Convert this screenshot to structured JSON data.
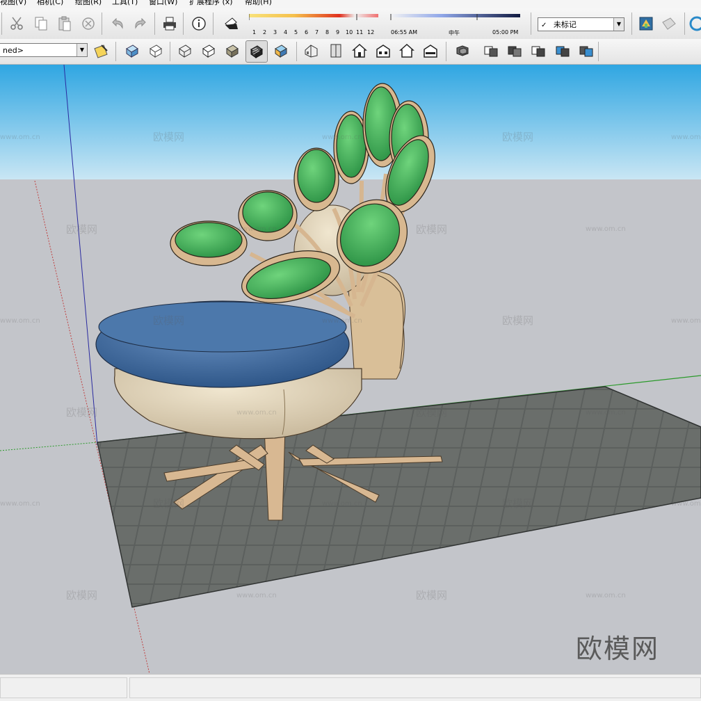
{
  "menu": {
    "items": [
      "视图(V)",
      "相机(C)",
      "绘图(R)",
      "工具(T)",
      "窗口(W)",
      "扩展程序 (x)",
      "帮助(H)"
    ]
  },
  "shadow": {
    "month_labels": [
      "1",
      "2",
      "3",
      "4",
      "5",
      "6",
      "7",
      "8",
      "9",
      "10",
      "11",
      "12"
    ],
    "time_start": "06:55 AM",
    "time_mid": "中午",
    "time_end": "05:00 PM"
  },
  "layer": {
    "value": "未标记",
    "check": "✓"
  },
  "style": {
    "value": "ned>"
  },
  "watermark": {
    "text": "欧模网",
    "url": "www.om.cn",
    "brand": "欧模网"
  },
  "colors": {
    "sky_top": "#2fa6e2",
    "sky_bottom": "#c9e6f4",
    "ground": "#c3c5ca",
    "leaf_green": "#3eb35a",
    "seat_blue": "#3e6fa3",
    "wood": "#d6b690",
    "floor": "#5b5f5d"
  },
  "icons": {
    "row1": [
      "cut-icon",
      "copy-icon",
      "paste-icon",
      "erase-icon",
      "undo-icon",
      "redo-icon",
      "print-icon",
      "model-info-icon",
      "shadow-toggle-icon",
      "warehouse-icon",
      "extension-icon",
      "sketchup-icon"
    ],
    "row2": [
      "style-eyedropper-icon",
      "xray-icon",
      "back-edges-icon",
      "wireframe-icon",
      "hidden-line-icon",
      "shaded-icon",
      "shaded-textures-icon",
      "monochrome-icon",
      "iso-view-icon",
      "top-view-icon",
      "front-view-icon",
      "right-view-icon",
      "back-view-icon",
      "left-view-icon",
      "bottom-view-icon",
      "outer-shell-icon",
      "intersect-icon",
      "union-icon",
      "subtract-icon",
      "trim-icon",
      "split-icon"
    ]
  }
}
